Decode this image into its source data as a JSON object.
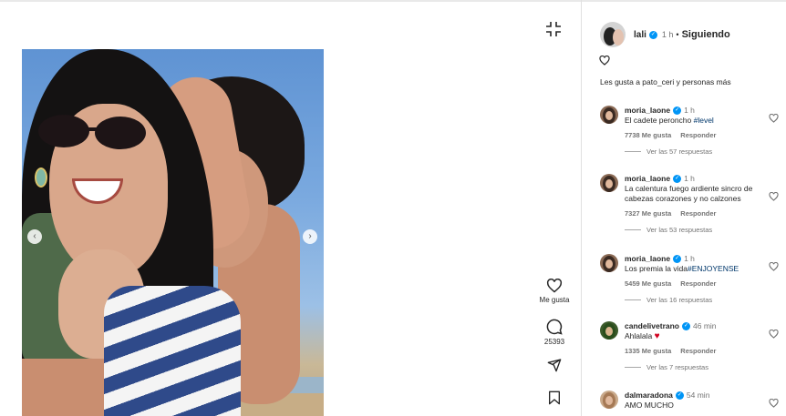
{
  "post": {
    "actions": {
      "like_label": "Me gusta",
      "comment_count": "25393"
    }
  },
  "header": {
    "username": "lali",
    "time": "1 h",
    "separator": "•",
    "follow_status": "Siguiendo"
  },
  "likes_text": "Les gusta a pato_ceri y personas más",
  "comments": [
    {
      "username": "moria_laone",
      "time": "1 h",
      "text": "El cadete peroncho ",
      "tag": "#level",
      "likes": "7738 Me gusta",
      "reply": "Responder",
      "replies": "Ver las 57 respuestas"
    },
    {
      "username": "moria_laone",
      "time": "1 h",
      "text": "La calentura fuego ardiente sincro de cabezas corazones y no calzones",
      "tag": "",
      "likes": "7327 Me gusta",
      "reply": "Responder",
      "replies": "Ver las 53 respuestas"
    },
    {
      "username": "moria_laone",
      "time": "1 h",
      "text": "Los premia la vida",
      "tag": "#ENJOYENSE",
      "likes": "5459 Me gusta",
      "reply": "Responder",
      "replies": "Ver las 16 respuestas"
    },
    {
      "username": "candelivetrano",
      "time": "46 min",
      "text": "Ahlalala ",
      "emoji": "heart",
      "likes": "1335 Me gusta",
      "reply": "Responder",
      "replies": "Ver las 7 respuestas"
    },
    {
      "username": "dalmaradona",
      "time": "54 min",
      "text": "AMO MUCHO"
    }
  ],
  "colors": {
    "verified": "#0095f6",
    "link": "#00376b",
    "muted": "#737373",
    "heart_emoji": "#d1001f"
  },
  "icons": [
    "collapse-icon",
    "heart-icon",
    "comment-icon",
    "share-icon",
    "bookmark-icon",
    "chevron-left-icon",
    "chevron-right-icon",
    "verified-icon"
  ]
}
